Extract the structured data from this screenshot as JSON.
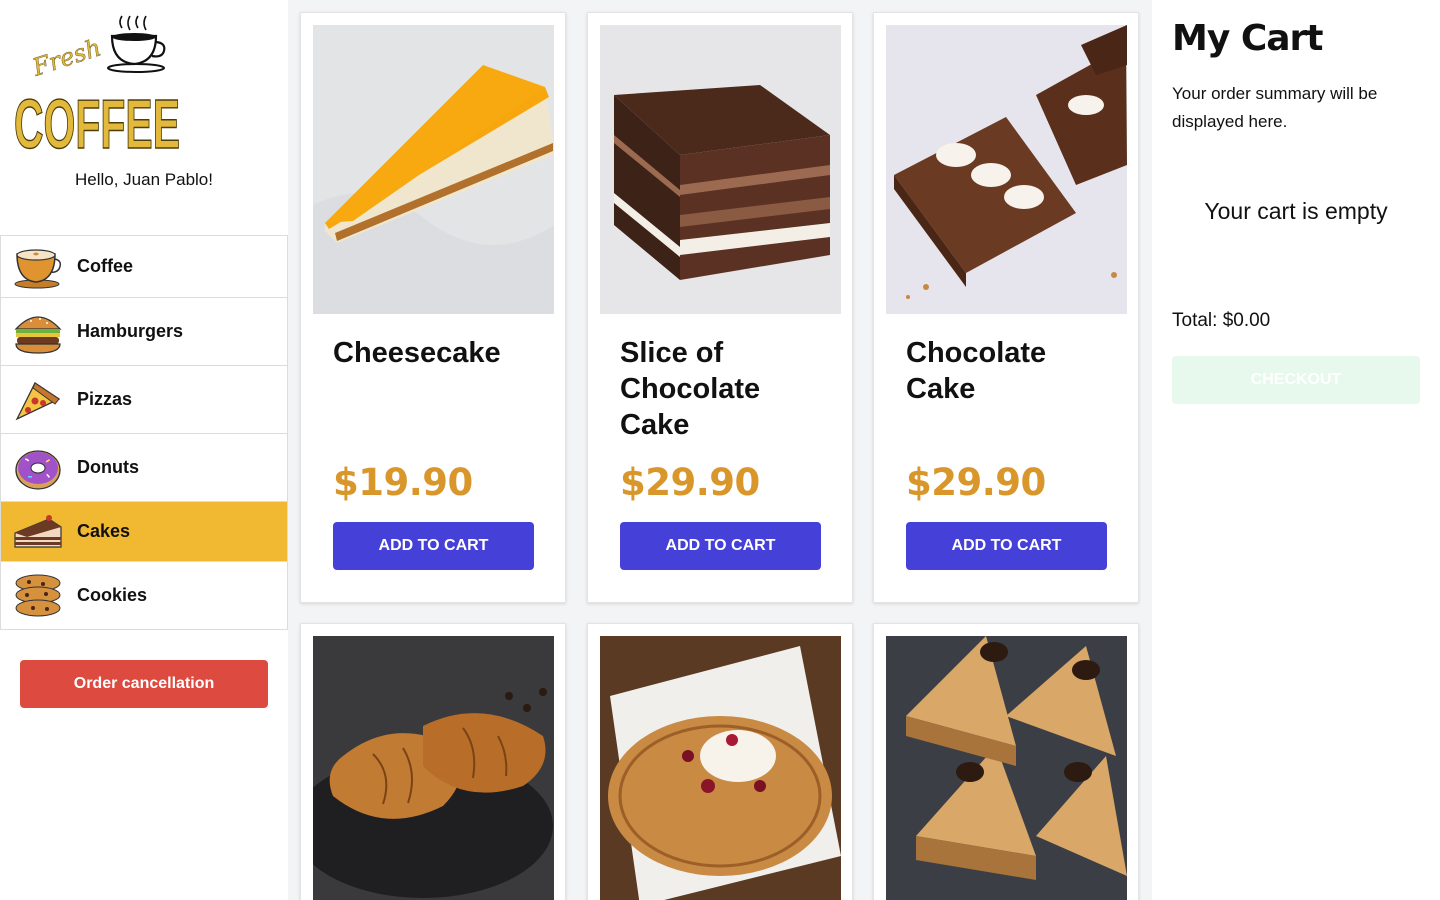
{
  "sidebar": {
    "brand_script": "Fresh",
    "brand_name": "COFFEE",
    "greeting": "Hello, Juan Pablo!",
    "categories": [
      {
        "label": "Coffee",
        "icon": "coffee-cup-icon"
      },
      {
        "label": "Hamburgers",
        "icon": "hamburger-icon"
      },
      {
        "label": "Pizzas",
        "icon": "pizza-slice-icon"
      },
      {
        "label": "Donuts",
        "icon": "donut-icon"
      },
      {
        "label": "Cakes",
        "icon": "cake-slice-icon",
        "active": true
      },
      {
        "label": "Cookies",
        "icon": "cookies-icon"
      }
    ],
    "cancel_label": "Order cancellation"
  },
  "products": [
    {
      "name": "Cheesecake",
      "price": "$19.90",
      "button": "ADD TO CART",
      "image": "cheesecake-photo"
    },
    {
      "name": "Slice of Chocolate Cake",
      "price": "$29.90",
      "button": "ADD TO CART",
      "image": "chocolate-cake-slice-photo"
    },
    {
      "name": "Chocolate Cake",
      "price": "$29.90",
      "button": "ADD TO CART",
      "image": "chocolate-bars-photo"
    },
    {
      "image": "croissants-photo"
    },
    {
      "image": "waffle-photo"
    },
    {
      "image": "layer-cake-photo"
    }
  ],
  "cart": {
    "title": "My Cart",
    "description": "Your order summary will be displayed here.",
    "empty_message": "Your cart is empty",
    "total": "Total: $0.00",
    "checkout_label": "CHECKOUT"
  },
  "colors": {
    "active_category": "#f0b931",
    "price": "#d9972b",
    "add_button": "#4540d8",
    "cancel_button": "#dd4a3f",
    "checkout_disabled": "#e6f9ec"
  }
}
